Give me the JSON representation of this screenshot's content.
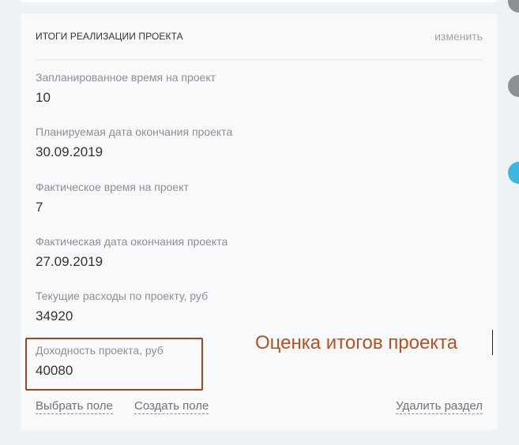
{
  "card": {
    "title": "ИТОГИ РЕАЛИЗАЦИИ ПРОЕКТА",
    "edit_label": "изменить",
    "fields": [
      {
        "label": "Запланированное время на проект",
        "value": "10"
      },
      {
        "label": "Планируемая дата окончания проекта",
        "value": "30.09.2019"
      },
      {
        "label": "Фактическое время на проект",
        "value": "7"
      },
      {
        "label": "Фактическая дата окончания проекта",
        "value": "27.09.2019"
      },
      {
        "label": "Текущие расходы по проекту, руб",
        "value": "34920"
      },
      {
        "label": "Доходность проекта, руб",
        "value": "40080"
      }
    ],
    "footer": {
      "choose_field": "Выбрать поле",
      "create_field": "Создать поле",
      "delete_section": "Удалить раздел"
    }
  },
  "annotation": {
    "text": "Оценка итогов проекта",
    "color": "#b5501f"
  },
  "colors": {
    "background": "#eef2f4",
    "card": "#f8f9fb",
    "highlight_border": "#a3451c",
    "side_marker_gray": "#8d9094",
    "side_marker_blue": "#3cb8e0"
  }
}
